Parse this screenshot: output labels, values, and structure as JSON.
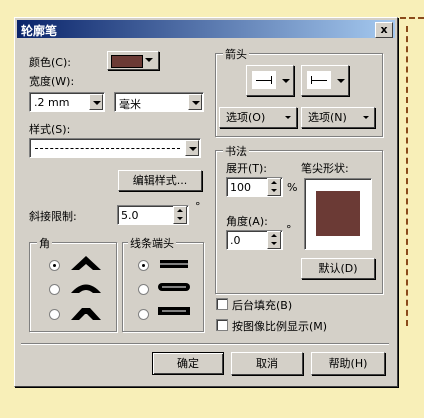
{
  "window": {
    "title": "轮廓笔",
    "close_glyph": "x"
  },
  "color": {
    "label": "颜色(C):",
    "swatch_color": "#6b3a35"
  },
  "width": {
    "label": "宽度(W):",
    "value": ".2 mm",
    "unit_value": "毫米"
  },
  "style": {
    "label": "样式(S):",
    "edit_button": "编辑样式..."
  },
  "miter": {
    "label": "斜接限制:",
    "value": "5.0",
    "unit": "°"
  },
  "corners": {
    "label": "角",
    "options": [
      "miter-corner",
      "round-corner",
      "bevel-corner"
    ],
    "selected_index": 0
  },
  "line_caps": {
    "label": "线条端头",
    "options": [
      "butt-cap",
      "round-cap",
      "square-cap"
    ],
    "selected_index": 0
  },
  "arrows": {
    "label": "箭头",
    "options_left": "选项(O)",
    "options_right": "选项(N)"
  },
  "calligraphy": {
    "label": "书法",
    "stretch_label": "展开(T):",
    "stretch_value": "100",
    "stretch_unit": "%",
    "angle_label": "角度(A):",
    "angle_value": ".0",
    "angle_unit": "°",
    "nib_label": "笔尖形状:",
    "nib_color": "#6b3a35",
    "default_button": "默认(D)"
  },
  "checkboxes": {
    "behind_fill": "后台填充(B)",
    "scale_with_image": "按图像比例显示(M)"
  },
  "buttons": {
    "ok": "确定",
    "cancel": "取消",
    "help": "帮助(H)"
  }
}
